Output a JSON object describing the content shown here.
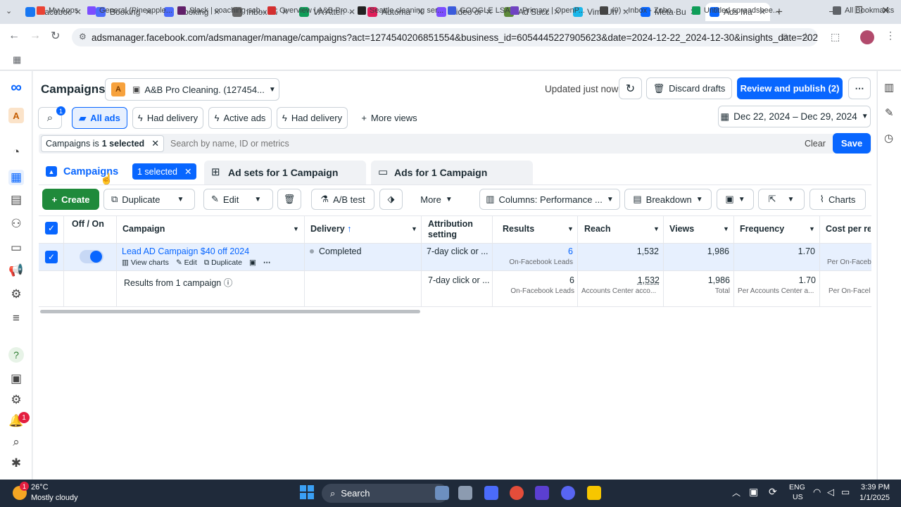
{
  "tabs": [
    {
      "title": "Faceboo",
      "color": "#1877f2"
    },
    {
      "title": "Booking",
      "color": "#4b6bfb"
    },
    {
      "title": "Booking",
      "color": "#4b6bfb"
    },
    {
      "title": "Inbox - 7",
      "color": "#666"
    },
    {
      "title": "VA Atten",
      "color": "#0f9d58"
    },
    {
      "title": "Automa",
      "color": "#e01e5a"
    },
    {
      "title": "Video or",
      "color": "#7c4dff"
    },
    {
      "title": "Ad Succ",
      "color": "#5d8a3a"
    },
    {
      "title": "VimeUh",
      "color": "#1ab7ea"
    },
    {
      "title": "Meta Bu",
      "color": "#0866ff"
    },
    {
      "title": "Ads Ma",
      "color": "#0866ff"
    }
  ],
  "url": "adsmanager.facebook.com/adsmanager/manage/campaigns?act=127454020685155​4&business_id=605444522790562​3&date=2024-12-22_2024-12-30&insights_date=2024-12-22_2024-...",
  "bookmarks": [
    "My Apps",
    "General (Pineapple...",
    "Slack | coaching-sch...",
    "Overview | A&B Pro...",
    "Seattle cleaning ser...",
    "GOOGLE LSA",
    "Primary | OpenP...",
    "(9) - Inbox - Zoho...",
    "Untitled spreadshee...",
    "All Bookmarks"
  ],
  "header": {
    "title": "Campaigns",
    "account_initial": "A",
    "account_name": "A&B Pro Cleaning. (127454...",
    "updated": "Updated just now",
    "discard": "Discard drafts",
    "publish": "Review and publish (2)"
  },
  "views": {
    "search_badge": "1",
    "all_ads": "All ads",
    "had_delivery_1": "Had delivery",
    "active_ads": "Active ads",
    "had_delivery_2": "Had delivery",
    "more_views": "More views",
    "date_range": "Dec 22, 2024 – Dec 29, 2024"
  },
  "filter": {
    "chip_prefix": "Campaigns is ",
    "chip_bold": "1 selected",
    "placeholder": "Search by name, ID or metrics",
    "clear": "Clear",
    "save": "Save"
  },
  "level_tabs": {
    "campaigns": "Campaigns",
    "selected": "1 selected",
    "adsets": "Ad sets for 1 Campaign",
    "ads": "Ads for 1 Campaign"
  },
  "toolbar": {
    "create": "Create",
    "duplicate": "Duplicate",
    "edit": "Edit",
    "ab_test": "A/B test",
    "more": "More",
    "columns": "Columns: Performance ...",
    "breakdown": "Breakdown",
    "charts": "Charts"
  },
  "columns": {
    "offon": "Off / On",
    "campaign": "Campaign",
    "delivery": "Delivery",
    "attribution": "Attribution setting",
    "results": "Results",
    "reach": "Reach",
    "views": "Views",
    "frequency": "Frequency",
    "cost": "Cost per res"
  },
  "row": {
    "name": "Lead AD Campaign $40 off 2024",
    "view_charts": "View charts",
    "edit": "Edit",
    "duplicate": "Duplicate",
    "delivery": "Completed",
    "attribution": "7-day click or ...",
    "results": "6",
    "results_sub": "On-Facebook Leads",
    "reach": "1,532",
    "views": "1,986",
    "frequency": "1.70",
    "cost_sub": "Per On-Faceb"
  },
  "summary": {
    "label": "Results from 1 campaign",
    "attribution": "7-day click or ...",
    "results": "6",
    "results_sub": "On-Facebook Leads",
    "reach": "1,532",
    "reach_sub": "Accounts Center acco...",
    "views": "1,986",
    "views_sub": "Total",
    "frequency": "1.70",
    "frequency_sub": "Per Accounts Center a...",
    "cost_sub": "Per On-Facel"
  },
  "rail": {
    "notif_badge": "1"
  },
  "taskbar": {
    "temp": "26°C",
    "weather": "Mostly cloudy",
    "weather_badge": "1",
    "search": "Search",
    "lang": "ENG",
    "region": "US",
    "time": "3:39 PM",
    "date": "1/1/2025"
  }
}
